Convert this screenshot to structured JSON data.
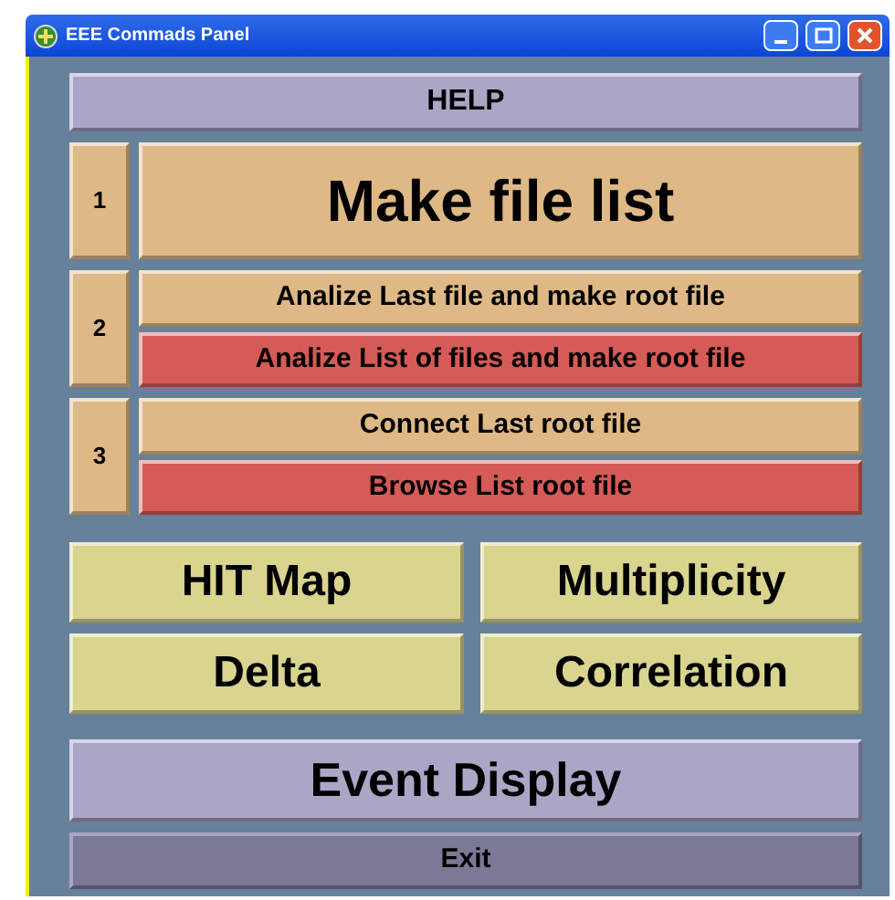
{
  "window": {
    "title": "EEE Commads Panel"
  },
  "help_button": "HELP",
  "steps": [
    {
      "number": "1",
      "buttons": [
        {
          "label": "Make file list",
          "color": "#dfb985"
        }
      ]
    },
    {
      "number": "2",
      "buttons": [
        {
          "label": "Analize Last file and make root file",
          "color": "#dfb985"
        },
        {
          "label": "Analize List of files and make root file",
          "color": "#d65a55"
        }
      ]
    },
    {
      "number": "3",
      "buttons": [
        {
          "label": "Connect Last root file",
          "color": "#dfb985"
        },
        {
          "label": "Browse List root file",
          "color": "#d65a55"
        }
      ]
    }
  ],
  "analysis_buttons": [
    "HIT Map",
    "Multiplicity",
    "Delta",
    "Correlation"
  ],
  "event_display_button": "Event Display",
  "exit_button": "Exit"
}
